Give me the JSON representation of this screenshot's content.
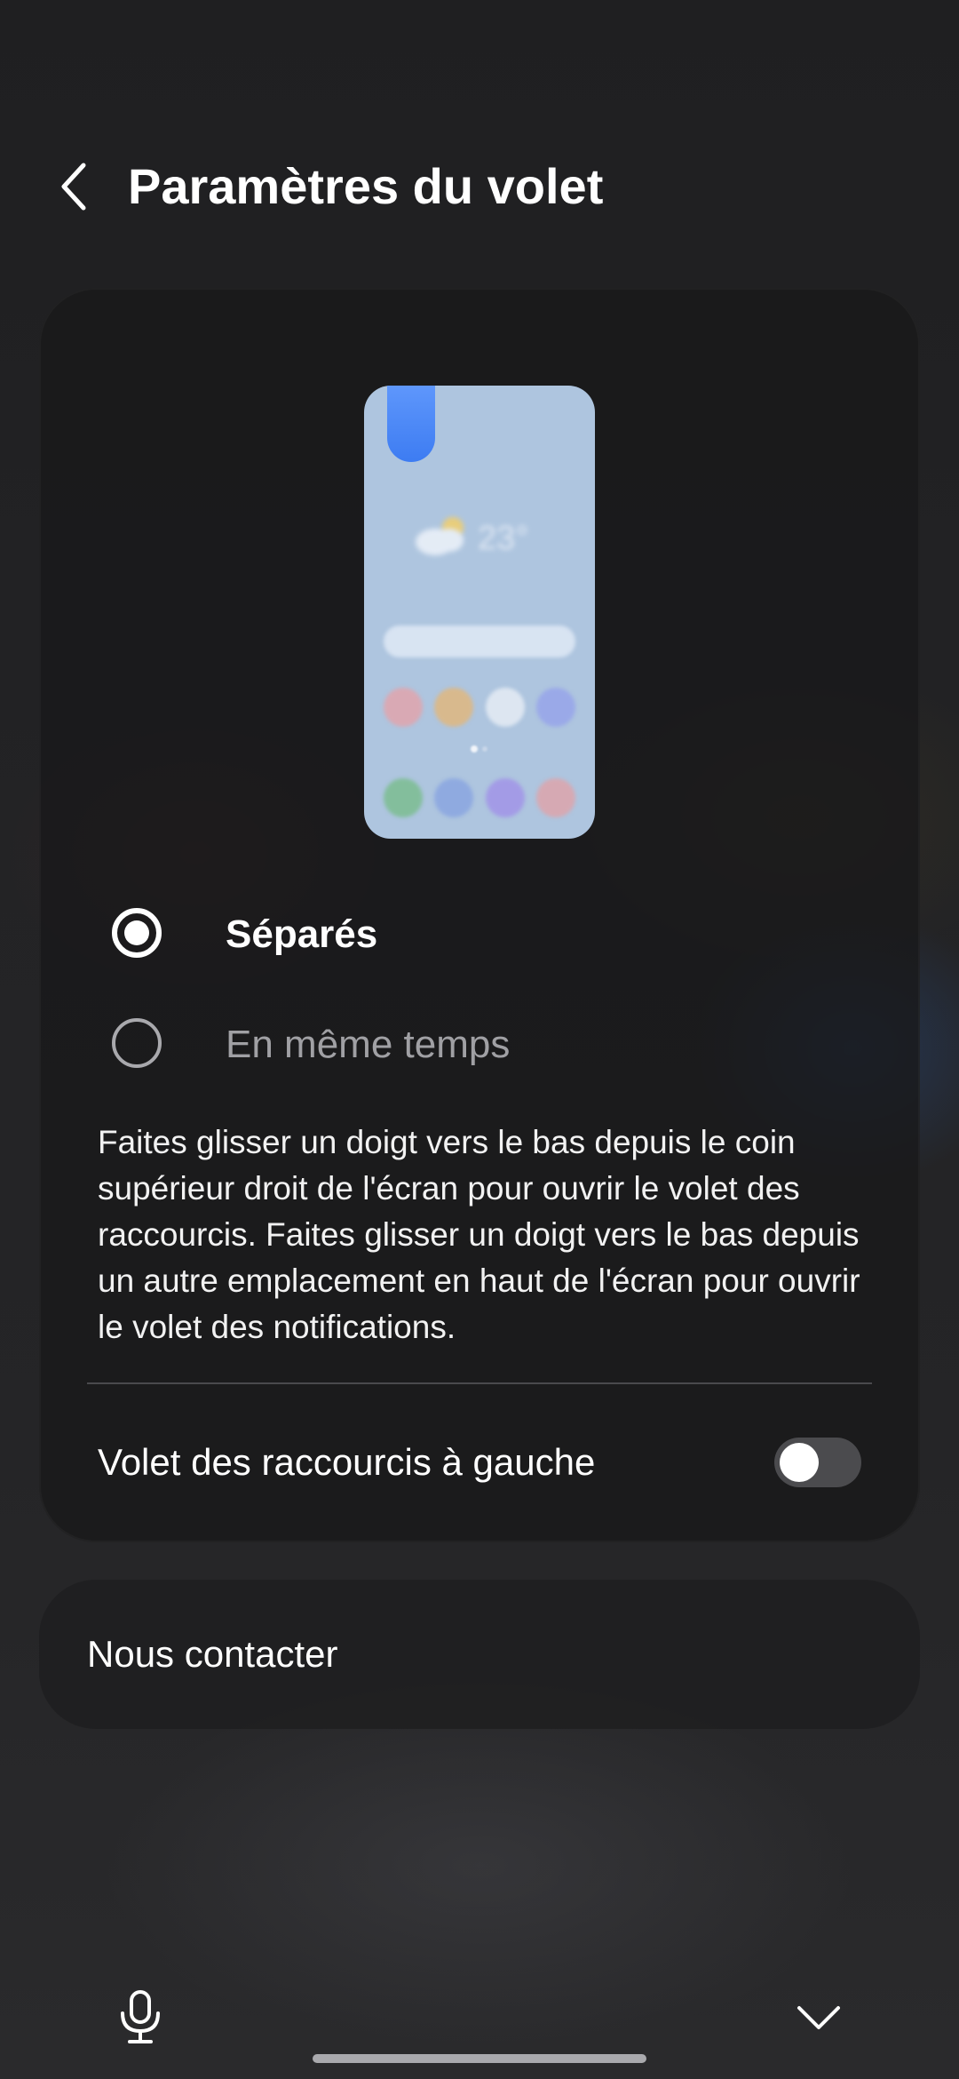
{
  "header": {
    "title": "Paramètres du volet",
    "back_icon": "chevron-left-icon"
  },
  "preview": {
    "temperature": "23°",
    "weather_icon": "partly-sunny-icon",
    "screen_color": "#aec5df",
    "pill_color": "#3d7cf2"
  },
  "options": [
    {
      "label": "Séparés",
      "selected": true
    },
    {
      "label": "En même temps",
      "selected": false
    }
  ],
  "description": "Faites glisser un doigt vers le bas depuis le coin supérieur droit de l'écran pour ouvrir le volet des raccourcis. Faites glisser un doigt vers le bas depuis un autre emplacement en haut de l'écran pour ouvrir le volet des notifications.",
  "toggle": {
    "label": "Volet des raccourcis à gauche",
    "on": false
  },
  "contact": {
    "label": "Nous contacter"
  },
  "bottom_bar": {
    "mic_icon": "microphone-icon",
    "collapse_icon": "chevron-down-icon"
  }
}
